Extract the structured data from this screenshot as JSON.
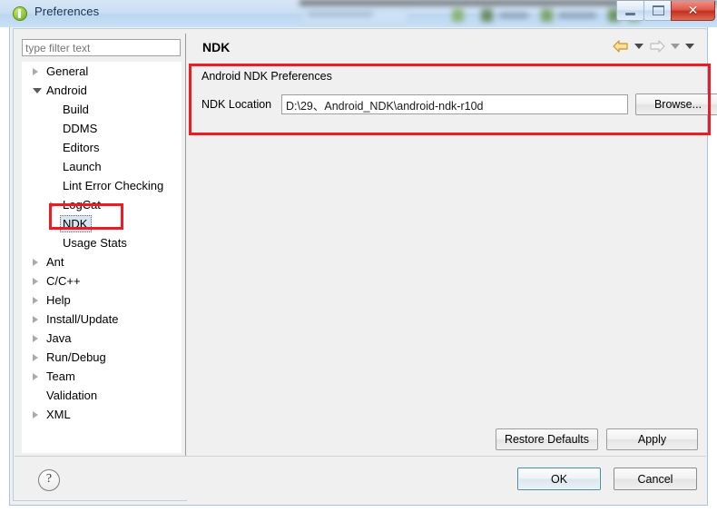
{
  "window": {
    "title": "Preferences",
    "icon": "eclipse-preferences-icon",
    "controls": {
      "minimize_label": "",
      "maximize_label": "",
      "close_label": "✕"
    }
  },
  "sidebar": {
    "filter": {
      "placeholder": "type filter text",
      "value": ""
    },
    "items": [
      {
        "label": "General",
        "level": 1,
        "state": "collapsed",
        "selected": false
      },
      {
        "label": "Android",
        "level": 1,
        "state": "expanded",
        "selected": false
      },
      {
        "label": "Build",
        "level": 2,
        "state": "leaf",
        "selected": false
      },
      {
        "label": "DDMS",
        "level": 2,
        "state": "leaf",
        "selected": false
      },
      {
        "label": "Editors",
        "level": 2,
        "state": "leaf",
        "selected": false
      },
      {
        "label": "Launch",
        "level": 2,
        "state": "leaf",
        "selected": false
      },
      {
        "label": "Lint Error Checking",
        "level": 2,
        "state": "leaf",
        "selected": false
      },
      {
        "label": "LogCat",
        "level": 2,
        "state": "collapsed",
        "selected": false
      },
      {
        "label": "NDK",
        "level": 2,
        "state": "leaf",
        "selected": true
      },
      {
        "label": "Usage Stats",
        "level": 2,
        "state": "leaf",
        "selected": false
      },
      {
        "label": "Ant",
        "level": 1,
        "state": "collapsed",
        "selected": false
      },
      {
        "label": "C/C++",
        "level": 1,
        "state": "collapsed",
        "selected": false
      },
      {
        "label": "Help",
        "level": 1,
        "state": "collapsed",
        "selected": false
      },
      {
        "label": "Install/Update",
        "level": 1,
        "state": "collapsed",
        "selected": false
      },
      {
        "label": "Java",
        "level": 1,
        "state": "collapsed",
        "selected": false
      },
      {
        "label": "Run/Debug",
        "level": 1,
        "state": "collapsed",
        "selected": false
      },
      {
        "label": "Team",
        "level": 1,
        "state": "collapsed",
        "selected": false
      },
      {
        "label": "Validation",
        "level": 1,
        "state": "leaf",
        "selected": false
      },
      {
        "label": "XML",
        "level": 1,
        "state": "collapsed",
        "selected": false
      }
    ]
  },
  "content": {
    "page_title": "NDK",
    "nav": {
      "back_icon": "arrow-left-icon",
      "back_menu_icon": "chevron-down-icon",
      "forward_icon": "arrow-right-icon",
      "forward_menu_icon": "chevron-down-icon",
      "view_menu_icon": "chevron-down-icon"
    },
    "group_title": "Android NDK Preferences",
    "ndk_location": {
      "label": "NDK Location",
      "value": "D:\\29、Android_NDK\\android-ndk-r10d",
      "placeholder": ""
    },
    "browse_label": "Browse...",
    "restore_defaults_label": "Restore Defaults",
    "apply_label": "Apply"
  },
  "footer": {
    "help_label": "?",
    "ok_label": "OK",
    "cancel_label": "Cancel"
  },
  "annotations": {
    "color": "#ec1c24",
    "regions": [
      "ndk-tree-item",
      "android-ndk-preferences-panel"
    ]
  }
}
